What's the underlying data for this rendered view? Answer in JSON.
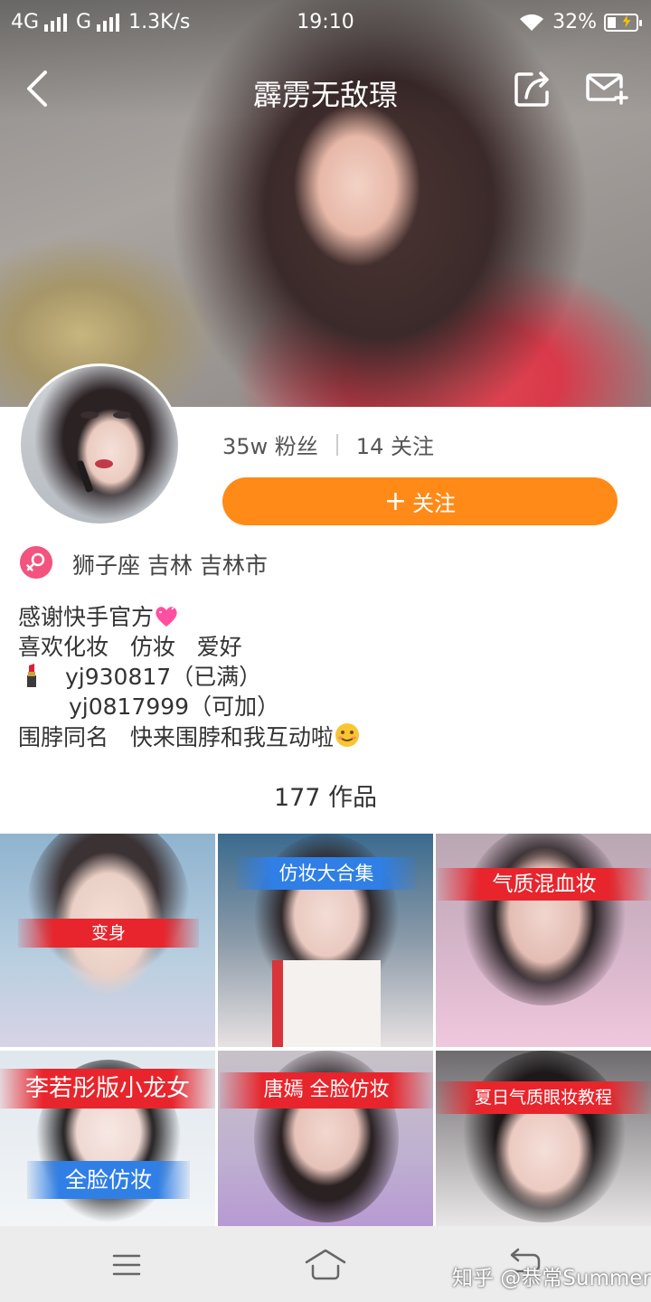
{
  "status_bar": {
    "network_1": "4G",
    "network_2": "G",
    "speed": "1.3K/s",
    "time": "19:10",
    "battery": "32%"
  },
  "header": {
    "title": "霹雳无敌璟"
  },
  "profile": {
    "followers": "35w 粉丝",
    "following": "14 关注",
    "follow_button": "关注",
    "location": "狮子座   吉林 吉林市"
  },
  "bio": {
    "line1": "感谢快手官方",
    "line2": "喜欢化妆   仿妆   爱好",
    "line3": "yj930817（已满）",
    "line4": "yj0817999（可加）",
    "line5": "围脖同名   快来围脖和我互动啦"
  },
  "works": {
    "count": "177 作品",
    "tiles": [
      {
        "label": "变身"
      },
      {
        "label": "仿妆大合集"
      },
      {
        "label": "气质混血妆"
      },
      {
        "label": "李若彤版小龙女",
        "label2": "全脸仿妆"
      },
      {
        "label": "唐嫣   全脸仿妆"
      },
      {
        "label": "夏日气质眼妆教程"
      }
    ]
  },
  "watermark": "知乎 @恭常Summer",
  "colors": {
    "accent": "#ff8a17",
    "gender": "#f2547f",
    "banner_red": "#e8252c",
    "banner_blue": "#2f7fe6"
  }
}
